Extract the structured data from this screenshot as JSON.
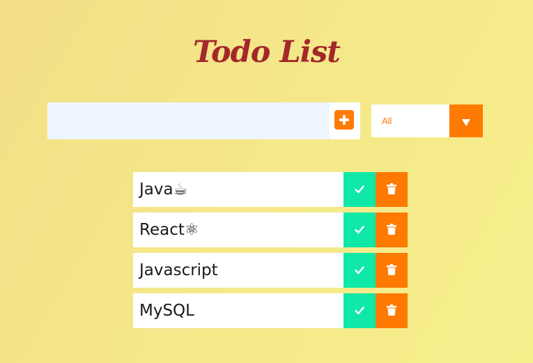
{
  "header": {
    "title": "Todo List"
  },
  "form": {
    "input_value": "",
    "filter_selected": "All"
  },
  "todos": [
    {
      "text": "Java☕"
    },
    {
      "text": "React⚛"
    },
    {
      "text": "Javascript"
    },
    {
      "text": "MySQL"
    }
  ],
  "colors": {
    "accent": "#ff7a00",
    "complete": "#10e8a8",
    "title": "#a3282a",
    "background": "#f5e98a"
  }
}
